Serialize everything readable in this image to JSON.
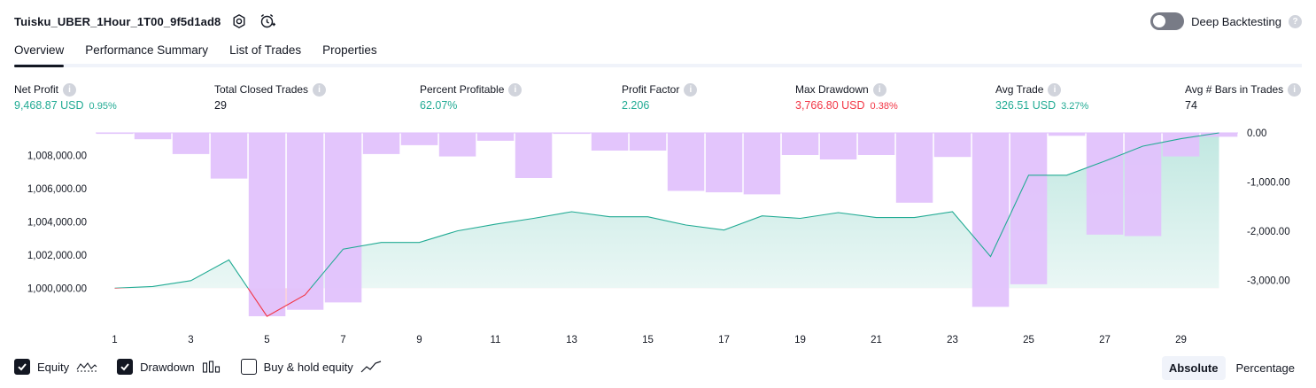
{
  "header": {
    "title": "Tuisku_UBER_1Hour_1T00_9f5d1ad8",
    "deep_backtesting_label": "Deep Backtesting"
  },
  "tabs": [
    {
      "label": "Overview"
    },
    {
      "label": "Performance Summary"
    },
    {
      "label": "List of Trades"
    },
    {
      "label": "Properties"
    }
  ],
  "metrics": {
    "net_profit": {
      "label": "Net Profit",
      "value": "9,468.87 USD",
      "pct": "0.95%"
    },
    "total_closed_trades": {
      "label": "Total Closed Trades",
      "value": "29"
    },
    "percent_profitable": {
      "label": "Percent Profitable",
      "value": "62.07%"
    },
    "profit_factor": {
      "label": "Profit Factor",
      "value": "2.206"
    },
    "max_drawdown": {
      "label": "Max Drawdown",
      "value": "3,766.80 USD",
      "pct": "0.38%"
    },
    "avg_trade": {
      "label": "Avg Trade",
      "value": "326.51 USD",
      "pct": "3.27%"
    },
    "avg_bars": {
      "label": "Avg # Bars in Trades",
      "value": "74"
    }
  },
  "legend": {
    "equity": "Equity",
    "drawdown": "Drawdown",
    "buy_hold": "Buy & hold equity"
  },
  "scale": {
    "absolute": "Absolute",
    "percentage": "Percentage"
  },
  "colors": {
    "equity_line": "#22ab94",
    "equity_line_below": "#f23645",
    "drawdown_bar": "#e1c2fc",
    "positive": "#22ab94",
    "negative": "#f23645"
  },
  "chart_data": {
    "type": "line",
    "x_ticks": [
      1,
      3,
      5,
      7,
      9,
      11,
      13,
      15,
      17,
      19,
      21,
      23,
      25,
      27,
      29
    ],
    "left_axis_ticks": [
      "1,000,000.00",
      "1,002,000.00",
      "1,004,000.00",
      "1,006,000.00",
      "1,008,000.00"
    ],
    "right_axis_ticks": [
      "0.00",
      "-1,000.00",
      "-2,000.00",
      "-3,000.00"
    ],
    "ylim_left": [
      998200,
      1009350
    ],
    "ylim_right": [
      -3766.8,
      0
    ],
    "baseline": 1000000,
    "series": [
      {
        "name": "Equity",
        "x": [
          1,
          2,
          3,
          4,
          5,
          6,
          7,
          8,
          9,
          10,
          11,
          12,
          13,
          14,
          15,
          16,
          17,
          18,
          19,
          20,
          21,
          22,
          23,
          24,
          25,
          26,
          27,
          28,
          29,
          30
        ],
        "values": [
          1000000,
          1000100,
          1000450,
          1001700,
          998300,
          999600,
          1002350,
          1002750,
          1002750,
          1003450,
          1003850,
          1004200,
          1004600,
          1004300,
          1004300,
          1003800,
          1003500,
          1004350,
          1004200,
          1004550,
          1004250,
          1004250,
          1004600,
          1001900,
          1006800,
          1006800,
          1007650,
          1008550,
          1009000,
          1009350
        ]
      },
      {
        "name": "Drawdown",
        "x": [
          1,
          2,
          3,
          4,
          5,
          6,
          7,
          8,
          9,
          10,
          11,
          12,
          13,
          14,
          15,
          16,
          17,
          18,
          19,
          20,
          21,
          22,
          23,
          24,
          25,
          26,
          27,
          28,
          29,
          30
        ],
        "values": [
          -20,
          -130,
          -430,
          -930,
          -3730,
          -3600,
          -3450,
          -430,
          -250,
          -480,
          -160,
          -920,
          -20,
          -360,
          -360,
          -1180,
          -1210,
          -1250,
          -450,
          -540,
          -450,
          -1420,
          -490,
          -3540,
          -3080,
          -60,
          -2070,
          -2100,
          -480,
          -80
        ]
      }
    ]
  }
}
